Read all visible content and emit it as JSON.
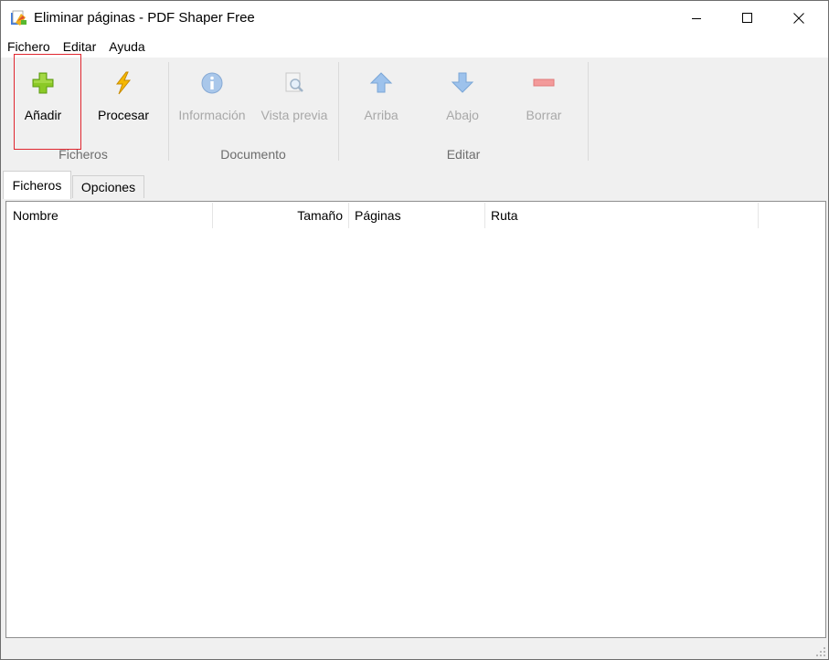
{
  "window": {
    "title": "Eliminar páginas - PDF Shaper Free"
  },
  "menu": [
    "Fichero",
    "Editar",
    "Ayuda"
  ],
  "ribbon": {
    "buttons": {
      "anadir": "Añadir",
      "procesar": "Procesar",
      "informacion": "Información",
      "vista_previa": "Vista previa",
      "arriba": "Arriba",
      "abajo": "Abajo",
      "borrar": "Borrar"
    },
    "groups": {
      "ficheros": "Ficheros",
      "documento": "Documento",
      "editar": "Editar"
    }
  },
  "tabs": [
    "Ficheros",
    "Opciones"
  ],
  "table": {
    "columns": [
      "Nombre",
      "Tamaño",
      "Páginas",
      "Ruta"
    ],
    "rows": []
  },
  "colors": {
    "highlight_border": "#e0262f",
    "disabled_text": "#a8a8a8",
    "add_icon": "#7fc21b",
    "arrow_icon": "#7aaee6",
    "remove_icon": "#f08a8a"
  }
}
